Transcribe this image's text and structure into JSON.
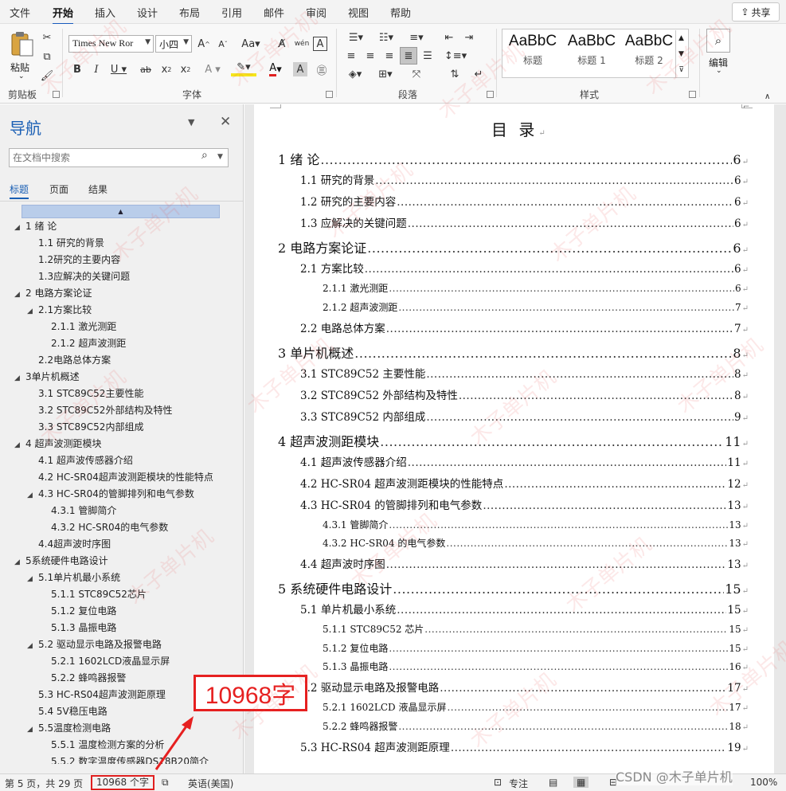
{
  "menu": {
    "tabs": [
      "文件",
      "开始",
      "插入",
      "设计",
      "布局",
      "引用",
      "邮件",
      "审阅",
      "视图",
      "帮助"
    ],
    "active_tab": "开始",
    "share_label": "共享"
  },
  "ribbon": {
    "clipboard": {
      "paste_label": "粘贴",
      "group_label": "剪贴板"
    },
    "font": {
      "font_name": "Times New Ror",
      "font_size": "小四",
      "group_label": "字体"
    },
    "paragraph": {
      "group_label": "段落"
    },
    "styles": {
      "items": [
        {
          "sample": "AaBbC",
          "name": "标题"
        },
        {
          "sample": "AaBbC",
          "name": "标题 1"
        },
        {
          "sample": "AaBbC",
          "name": "标题 2"
        }
      ],
      "group_label": "样式"
    },
    "editing": {
      "label": "编辑"
    }
  },
  "nav": {
    "title": "导航",
    "search_placeholder": "在文档中搜索",
    "tabs": [
      "标题",
      "页面",
      "结果"
    ],
    "items": [
      {
        "text": "1 绪 论",
        "level": 1,
        "expand": "◢"
      },
      {
        "text": "1.1 研究的背景",
        "level": 2,
        "expand": ""
      },
      {
        "text": "1.2研究的主要内容",
        "level": 2,
        "expand": ""
      },
      {
        "text": "1.3应解决的关键问题",
        "level": 2,
        "expand": ""
      },
      {
        "text": "2 电路方案论证",
        "level": 1,
        "expand": "◢"
      },
      {
        "text": "2.1方案比较",
        "level": 2,
        "expand": "◢"
      },
      {
        "text": "2.1.1 激光测距",
        "level": 3,
        "expand": ""
      },
      {
        "text": "2.1.2 超声波测距",
        "level": 3,
        "expand": ""
      },
      {
        "text": "2.2电路总体方案",
        "level": 2,
        "expand": ""
      },
      {
        "text": "3单片机概述",
        "level": 1,
        "expand": "◢"
      },
      {
        "text": "3.1 STC89C52主要性能",
        "level": 2,
        "expand": ""
      },
      {
        "text": "3.2 STC89C52外部结构及特性",
        "level": 2,
        "expand": ""
      },
      {
        "text": "3.3 STC89C52内部组成",
        "level": 2,
        "expand": ""
      },
      {
        "text": "4 超声波测距模块",
        "level": 1,
        "expand": "◢"
      },
      {
        "text": "4.1 超声波传感器介绍",
        "level": 2,
        "expand": ""
      },
      {
        "text": "4.2 HC-SR04超声波测距模块的性能特点",
        "level": 2,
        "expand": ""
      },
      {
        "text": "4.3 HC-SR04的管脚排列和电气参数",
        "level": 2,
        "expand": "◢"
      },
      {
        "text": "4.3.1 管脚简介",
        "level": 3,
        "expand": ""
      },
      {
        "text": "4.3.2 HC-SR04的电气参数",
        "level": 3,
        "expand": ""
      },
      {
        "text": "4.4超声波时序图",
        "level": 2,
        "expand": ""
      },
      {
        "text": "5系统硬件电路设计",
        "level": 1,
        "expand": "◢"
      },
      {
        "text": "5.1单片机最小系统",
        "level": 2,
        "expand": "◢"
      },
      {
        "text": "5.1.1 STC89C52芯片",
        "level": 3,
        "expand": ""
      },
      {
        "text": "5.1.2 复位电路",
        "level": 3,
        "expand": ""
      },
      {
        "text": "5.1.3 晶振电路",
        "level": 3,
        "expand": ""
      },
      {
        "text": "5.2 驱动显示电路及报警电路",
        "level": 2,
        "expand": "◢"
      },
      {
        "text": "5.2.1  1602LCD液晶显示屏",
        "level": 3,
        "expand": ""
      },
      {
        "text": "5.2.2 蜂鸣器报警",
        "level": 3,
        "expand": ""
      },
      {
        "text": "5.3 HC-RS04超声波测距原理",
        "level": 2,
        "expand": ""
      },
      {
        "text": "5.4 5V稳压电路",
        "level": 2,
        "expand": ""
      },
      {
        "text": "5.5温度检测电路",
        "level": 2,
        "expand": "◢"
      },
      {
        "text": "5.5.1 温度检测方案的分析",
        "level": 3,
        "expand": ""
      },
      {
        "text": "5.5.2 数字温度传感器DS18B20简介",
        "level": 3,
        "expand": ""
      }
    ]
  },
  "document": {
    "toc_title": "目  录",
    "toc": [
      {
        "text": "1  绪  论",
        "page": "6",
        "level": 1
      },
      {
        "text": "1.1  研究的背景",
        "page": "6",
        "level": 2
      },
      {
        "text": "1.2 研究的主要内容",
        "page": "6",
        "level": 2
      },
      {
        "text": "1.3 应解决的关键问题",
        "page": "6",
        "level": 2
      },
      {
        "text": "2  电路方案论证",
        "page": "6",
        "level": 1
      },
      {
        "text": "2.1 方案比较",
        "page": "6",
        "level": 2
      },
      {
        "text": "2.1.1  激光测距",
        "page": "6",
        "level": 3
      },
      {
        "text": "2.1.2  超声波测距",
        "page": "7",
        "level": 3
      },
      {
        "text": "2.2 电路总体方案",
        "page": "7",
        "level": 2
      },
      {
        "text": "3 单片机概述",
        "page": "8",
        "level": 1
      },
      {
        "text": "3.1 STC89C52 主要性能",
        "page": "8",
        "level": 2
      },
      {
        "text": "3.2 STC89C52 外部结构及特性",
        "page": "8",
        "level": 2
      },
      {
        "text": "3.3 STC89C52 内部组成",
        "page": "9",
        "level": 2
      },
      {
        "text": "4  超声波测距模块",
        "page": "11",
        "level": 1
      },
      {
        "text": "4.1  超声波传感器介绍",
        "page": "11",
        "level": 2
      },
      {
        "text": "4.2 HC-SR04 超声波测距模块的性能特点",
        "page": "12",
        "level": 2
      },
      {
        "text": "4.3 HC-SR04 的管脚排列和电气参数",
        "page": "13",
        "level": 2
      },
      {
        "text": "4.3.1  管脚简介",
        "page": "13",
        "level": 3
      },
      {
        "text": "4.3.2 HC-SR04 的电气参数",
        "page": "13",
        "level": 3
      },
      {
        "text": "4.4 超声波时序图",
        "page": "13",
        "level": 2
      },
      {
        "text": "5 系统硬件电路设计",
        "page": "15",
        "level": 1
      },
      {
        "text": "5.1 单片机最小系统",
        "page": "15",
        "level": 2
      },
      {
        "text": "5.1.1 STC89C52 芯片",
        "page": "15",
        "level": 3
      },
      {
        "text": "5.1.2  复位电路",
        "page": "15",
        "level": 3
      },
      {
        "text": "5.1.3  晶振电路",
        "page": "16",
        "level": 3
      },
      {
        "text": "5.2  驱动显示电路及报警电路",
        "page": "17",
        "level": 2
      },
      {
        "text": "5.2.1    1602LCD 液晶显示屏",
        "page": "17",
        "level": 3
      },
      {
        "text": "5.2.2  蜂鸣器报警",
        "page": "18",
        "level": 3
      },
      {
        "text": "5.3 HC-RS04 超声波测距原理",
        "page": "19",
        "level": 2
      }
    ]
  },
  "annotation": {
    "text": "10968字"
  },
  "statusbar": {
    "page_info": "第 5 页，共 29 页",
    "word_count": "10968 个字",
    "language": "英语(美国)",
    "focus": "专注",
    "zoom": "100%"
  },
  "watermark": {
    "text": "木子单片机",
    "credit": "CSDN @木子单片机"
  },
  "colors": {
    "accent": "#185abd",
    "nav_title": "#1a5fb4",
    "annotation": "#e62020"
  }
}
